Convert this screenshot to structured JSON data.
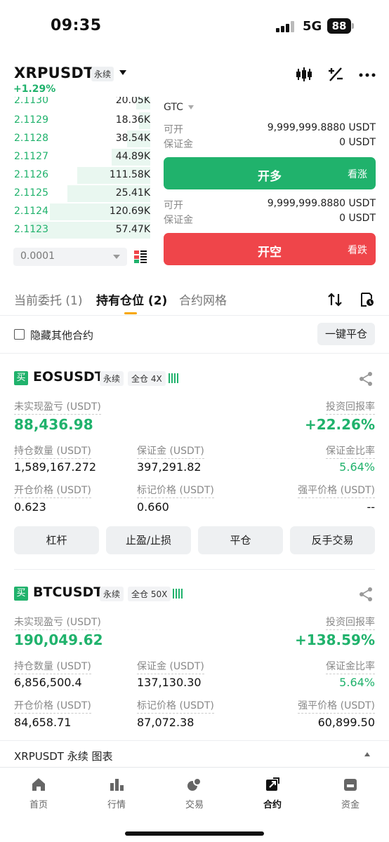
{
  "status": {
    "time": "09:35",
    "network": "5G",
    "battery": "88"
  },
  "header": {
    "symbol": "XRPUSDT",
    "contract_tag": "永续",
    "change": "+1.29%",
    "icons": [
      "candlestick-icon",
      "calculator-icon",
      "more-icon"
    ]
  },
  "orderbook": {
    "bids": [
      {
        "price": "2.1130",
        "qty": "20.05K",
        "depth": 0.1
      },
      {
        "price": "2.1129",
        "qty": "18.36K",
        "depth": 0.08
      },
      {
        "price": "2.1128",
        "qty": "38.54K",
        "depth": 0.17
      },
      {
        "price": "2.1127",
        "qty": "44.89K",
        "depth": 0.28
      },
      {
        "price": "2.1126",
        "qty": "111.58K",
        "depth": 0.53
      },
      {
        "price": "2.1125",
        "qty": "25.41K",
        "depth": 0.6
      },
      {
        "price": "2.1124",
        "qty": "120.69K",
        "depth": 0.73
      },
      {
        "price": "2.1123",
        "qty": "57.47K",
        "depth": 0.87
      }
    ],
    "precision": "0.0001"
  },
  "order_form": {
    "tif": "GTC",
    "long": {
      "available_label": "可开",
      "available_value": "9,999,999.8880 USDT",
      "margin_label": "保证金",
      "margin_value": "0 USDT",
      "button_label": "开多",
      "button_sub": "看涨"
    },
    "short": {
      "available_label": "可开",
      "available_value": "9,999,999.8880 USDT",
      "margin_label": "保证金",
      "margin_value": "0 USDT",
      "button_label": "开空",
      "button_sub": "看跌"
    }
  },
  "tabs": {
    "open_orders": "当前委托 (1)",
    "positions": "持有仓位 (2)",
    "grid": "合约网格"
  },
  "filter": {
    "hide_other": "隐藏其他合约",
    "close_all": "一键平仓"
  },
  "positions": [
    {
      "side": "买",
      "symbol": "EOSUSDT",
      "contract_tag": "永续",
      "mode_tag": "全仓 4X",
      "unrealized_pnl_label": "未实现盈亏 (USDT)",
      "unrealized_pnl": "88,436.98",
      "roi_label": "投资回报率",
      "roi": "+22.26%",
      "size_label": "持仓数量 (USDT)",
      "size": "1,589,167.272",
      "margin_label": "保证金 (USDT)",
      "margin": "397,291.82",
      "margin_ratio_label": "保证金比率",
      "margin_ratio": "5.64%",
      "entry_label": "开仓价格 (USDT)",
      "entry": "0.623",
      "mark_label": "标记价格 (USDT)",
      "mark": "0.660",
      "liq_label": "强平价格 (USDT)",
      "liq": "--",
      "actions": [
        "杠杆",
        "止盈/止损",
        "平仓",
        "反手交易"
      ]
    },
    {
      "side": "买",
      "symbol": "BTCUSDT",
      "contract_tag": "永续",
      "mode_tag": "全仓 50X",
      "unrealized_pnl_label": "未实现盈亏 (USDT)",
      "unrealized_pnl": "190,049.62",
      "roi_label": "投资回报率",
      "roi": "+138.59%",
      "size_label": "持仓数量 (USDT)",
      "size": "6,856,500.4",
      "margin_label": "保证金 (USDT)",
      "margin": "137,130.30",
      "margin_ratio_label": "保证金比率",
      "margin_ratio": "5.64%",
      "entry_label": "开仓价格 (USDT)",
      "entry": "84,658.71",
      "mark_label": "标记价格 (USDT)",
      "mark": "87,072.38",
      "liq_label": "强平价格 (USDT)",
      "liq": "60,899.50"
    }
  ],
  "chart_strip": {
    "label": "XRPUSDT 永续  图表"
  },
  "nav": [
    {
      "label": "首页",
      "icon": "home-icon"
    },
    {
      "label": "行情",
      "icon": "market-icon"
    },
    {
      "label": "交易",
      "icon": "trade-icon"
    },
    {
      "label": "合约",
      "icon": "contract-icon",
      "active": true
    },
    {
      "label": "资金",
      "icon": "wallet-icon"
    }
  ],
  "colors": {
    "green": "#20b26c",
    "red": "#ef454a",
    "accent": "#f7a600"
  }
}
